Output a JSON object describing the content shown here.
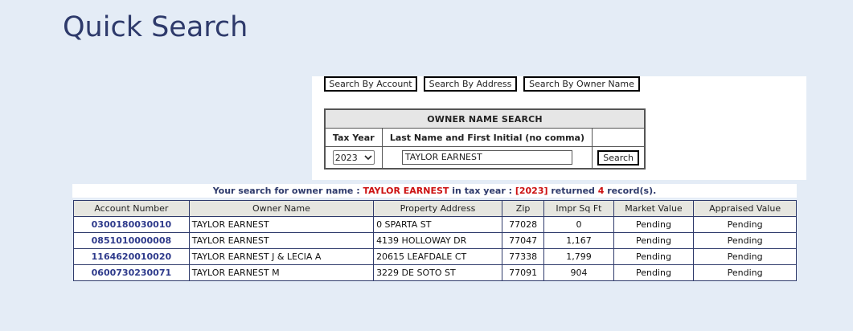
{
  "page": {
    "title": "Quick Search"
  },
  "search_modes": [
    {
      "label": "Search By Account"
    },
    {
      "label": "Search By Address"
    },
    {
      "label": "Search By Owner Name"
    }
  ],
  "form": {
    "title": "OWNER NAME SEARCH",
    "col_tax_year": "Tax Year",
    "col_name": "Last Name and First Initial (no comma)",
    "tax_year_value": "2023",
    "name_value": "TAYLOR EARNEST",
    "search_label": "Search"
  },
  "result_summary": {
    "prefix": "Your search for owner name : ",
    "owner": "TAYLOR EARNEST",
    "mid": " in tax year : ",
    "year": "[2023]",
    "returned": " returned ",
    "count": "4",
    "suffix": " record(s)."
  },
  "table": {
    "headers": [
      "Account Number",
      "Owner Name",
      "Property Address",
      "Zip",
      "Impr Sq Ft",
      "Market Value",
      "Appraised Value"
    ],
    "rows": [
      {
        "account": "0300180030010",
        "owner": "TAYLOR EARNEST",
        "address": "0 SPARTA ST",
        "zip": "77028",
        "sqft": "0",
        "market": "Pending",
        "appraised": "Pending"
      },
      {
        "account": "0851010000008",
        "owner": "TAYLOR EARNEST",
        "address": "4139 HOLLOWAY DR",
        "zip": "77047",
        "sqft": "1,167",
        "market": "Pending",
        "appraised": "Pending"
      },
      {
        "account": "1164620010020",
        "owner": "TAYLOR EARNEST J & LECIA A",
        "address": "20615 LEAFDALE CT",
        "zip": "77338",
        "sqft": "1,799",
        "market": "Pending",
        "appraised": "Pending"
      },
      {
        "account": "0600730230071",
        "owner": "TAYLOR EARNEST M",
        "address": "3229 DE SOTO ST",
        "zip": "77091",
        "sqft": "904",
        "market": "Pending",
        "appraised": "Pending"
      }
    ]
  }
}
